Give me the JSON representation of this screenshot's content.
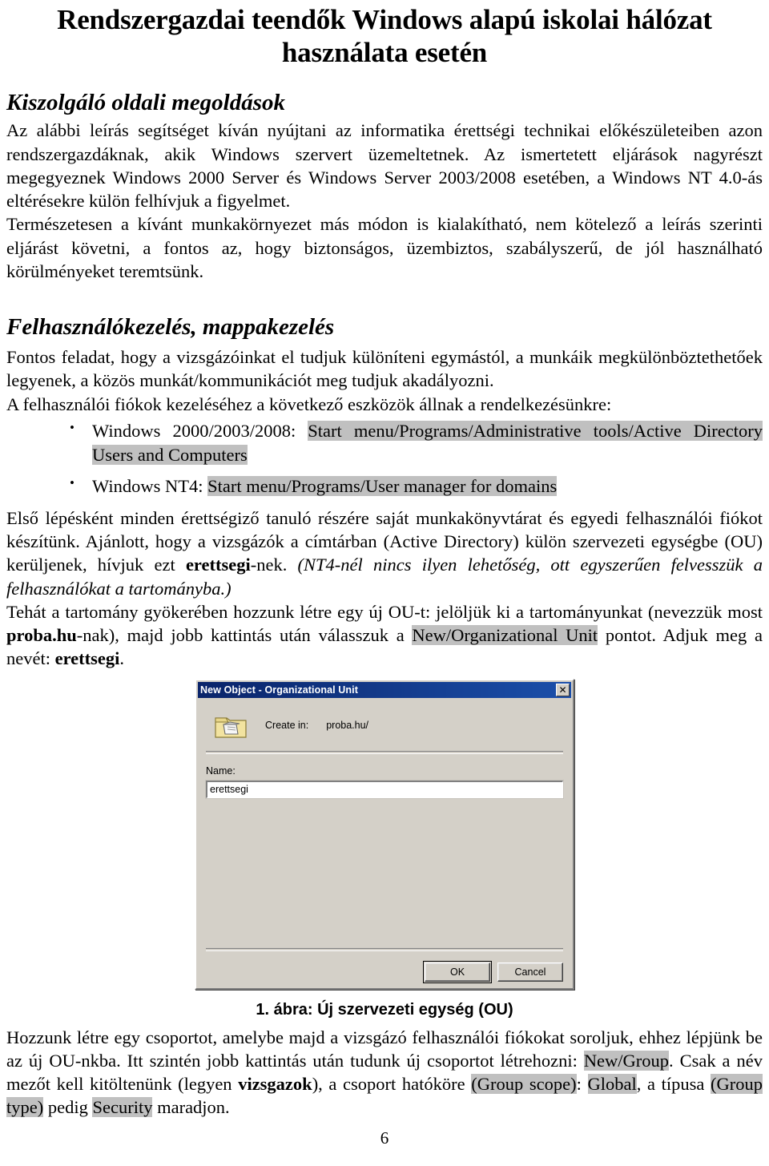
{
  "document": {
    "title": "Rendszergazdai teendők Windows alapú iskolai hálózat használata esetén",
    "page_number": "6"
  },
  "section1": {
    "heading": "Kiszolgáló oldali megoldások",
    "paragraph1_a": "Az alábbi leírás segítséget kíván nyújtani az informatika érettségi technikai előkészületeiben azon rendszergazdáknak, akik Windows szervert üzemeltetnek. Az ismertetett eljárások nagyrészt megegyeznek Windows 2000 Server és Windows Server 2003/2008 esetében, a Windows NT 4.0-ás eltérésekre külön felhívjuk a figyelmet.",
    "paragraph1_b": "Természetesen a kívánt munkakörnyezet más módon is kialakítható, nem kötelező a leírás szerinti eljárást követni, a fontos az, hogy biztonságos, üzembiztos, szabályszerű, de jól használható körülményeket teremtsünk."
  },
  "section2": {
    "heading": "Felhasználókezelés, mappakezelés",
    "paragraph_a": "Fontos feladat, hogy a vizsgázóinkat el tudjuk különíteni egymástól, a munkáik megkülönböztethetőek legyenek, a közös munkát/kommunikációt meg tudjuk akadályozni.",
    "paragraph_b": "A felhasználói fiókok kezeléséhez a következő eszközök állnak a rendelkezésünkre:",
    "bullets": [
      {
        "glyph": "•",
        "prefix": "Windows 2000/2003/2008: ",
        "highlight": "Start menu/Programs/Administrative tools/Active Directory Users and Computers"
      },
      {
        "glyph": "•",
        "prefix": "Windows NT4: ",
        "highlight": "Start menu/Programs/User manager for domains"
      }
    ],
    "paragraph_c_1": "Első lépésként minden érettségiző tanuló részére saját munkakönyvtárat és egyedi felhasználói fiókot készítünk. Ajánlott, hogy a vizsgázók a címtárban (Active Directory) külön szervezeti egységbe (OU) kerüljenek, hívjuk ezt ",
    "paragraph_c_bold": "erettsegi",
    "paragraph_c_2": "-nek. ",
    "paragraph_c_italic": "(NT4-nél nincs ilyen lehetőség, ott egyszerűen felvesszük a felhasználókat a tartományba.)",
    "paragraph_d_1": "Tehát a tartomány gyökerében hozzunk létre egy új OU-t: jelöljük ki a tartományunkat (nevezzük most ",
    "paragraph_d_bold1": "proba.hu",
    "paragraph_d_2": "-nak), majd jobb kattintás után válasszuk a ",
    "paragraph_d_hl": "New/Organizational Unit",
    "paragraph_d_3": " pontot. Adjuk meg a nevét: ",
    "paragraph_d_bold2": "erettsegi",
    "paragraph_d_4": "."
  },
  "dialog": {
    "title": "New Object - Organizational Unit",
    "close_label": "✕",
    "create_in_label": "Create in:",
    "create_in_value": "proba.hu/",
    "name_label": "Name:",
    "name_value": "erettsegi",
    "ok_label": "OK",
    "cancel_label": "Cancel",
    "colors": {
      "titlebar_start": "#0a246a",
      "titlebar_end": "#1b4faa",
      "face": "#d4d0c8",
      "field_bg": "#ffffff"
    }
  },
  "figure": {
    "caption": "1. ábra: Új szervezeti egység (OU)"
  },
  "section3": {
    "text_1": "Hozzunk létre egy csoportot, amelybe majd a vizsgázó felhasználói fiókokat soroljuk, ehhez lépjünk be az új OU-nkba. Itt szintén jobb kattintás után tudunk új csoportot létrehozni: ",
    "hl_1": "New/Group",
    "text_2": ". Csak a név mezőt kell kitöltenünk (legyen ",
    "bold_1": "vizsgazok",
    "text_3": "), a csoport hatóköre ",
    "hl_2": "(Group scope)",
    "text_4": ": ",
    "hl_3": "Global",
    "text_5": ", a típusa ",
    "hl_4": "(Group type)",
    "text_6": " pedig ",
    "hl_5": "Security",
    "text_7": " maradjon."
  },
  "highlight_color": "#c0c0c0"
}
